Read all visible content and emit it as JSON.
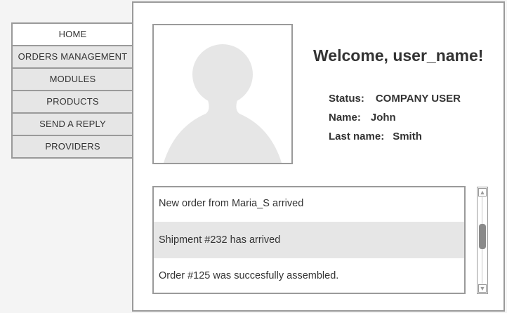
{
  "nav": {
    "items": [
      {
        "label": "HOME",
        "active": true
      },
      {
        "label": "ORDERS MANAGEMENT",
        "active": false
      },
      {
        "label": "MODULES",
        "active": false
      },
      {
        "label": "PRODUCTS",
        "active": false
      },
      {
        "label": "SEND A REPLY",
        "active": false
      },
      {
        "label": "PROVIDERS",
        "active": false
      }
    ]
  },
  "profile": {
    "welcome": "Welcome, user_name!",
    "status_label": "Status:",
    "status_value": "COMPANY USER",
    "name_label": "Name:",
    "name_value": "John",
    "last_name_label": "Last name:",
    "last_name_value": "Smith",
    "avatar_icon": "user-silhouette-icon"
  },
  "notifications": {
    "items": [
      {
        "text": "New order from Maria_S arrived",
        "selected": false
      },
      {
        "text": "Shipment #232 has arrived",
        "selected": true
      },
      {
        "text": "Order  #125 was succesfully assembled.",
        "selected": false
      }
    ]
  },
  "scrollbar": {
    "up_icon": "triangle-up-icon",
    "down_icon": "triangle-down-icon",
    "up_glyph": "▲",
    "down_glyph": "▼"
  },
  "colors": {
    "border": "#9a9a9a",
    "nav_bg": "#e6e6e6",
    "selected_row": "#e6e6e6",
    "avatar_fill": "#e6e6e6"
  }
}
